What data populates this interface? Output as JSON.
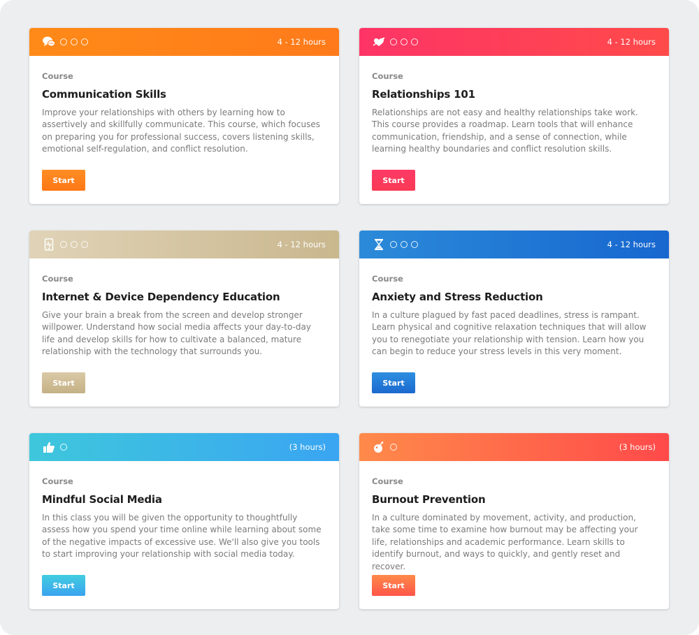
{
  "colors": {
    "background": "#edeef0",
    "orange": "#ff8a18",
    "red": "#fe3466",
    "tan": "#d6c8a5",
    "blue": "#2178d6",
    "cyan": "#3eb8e6",
    "coral": "#ff6a4a"
  },
  "cards": [
    {
      "icon": "chat-bubbles-icon",
      "duration": "4 - 12 hours",
      "label": "Course",
      "title": "Communication Skills",
      "description": "Improve your relationships with others by learning how to assertively and skillfully communicate. This course, which focuses on preparing you for professional success, covers listening skills, emotional self-regulation, and conflict resolution.",
      "button": "Start"
    },
    {
      "icon": "heart-arrow-icon",
      "duration": "4 - 12 hours",
      "label": "Course",
      "title": "Relationships 101",
      "description": "Relationships are not easy and healthy relationships take work. This course provides a roadmap. Learn tools that will enhance communication, friendship, and a sense of connection, while learning healthy boundaries and conflict resolution skills.",
      "button": "Start"
    },
    {
      "icon": "phone-heartbeat-icon",
      "duration": "4 - 12 hours",
      "label": "Course",
      "title": "Internet & Device Dependency Education",
      "description": "Give your brain a break from the screen and develop stronger willpower. Understand how social media affects your day-to-day life and develop skills for how to cultivate a balanced, mature relationship with the technology that surrounds you.",
      "button": "Start"
    },
    {
      "icon": "hourglass-icon",
      "duration": "4 - 12 hours",
      "label": "Course",
      "title": "Anxiety and Stress Reduction",
      "description": "In a culture plagued by fast paced deadlines, stress is rampant. Learn physical and cognitive relaxation techniques that will allow you to renegotiate your relationship with tension. Learn how you can begin to reduce your stress levels in this very moment.",
      "button": "Start"
    },
    {
      "icon": "thumbs-up-icon",
      "duration": "(3 hours)",
      "label": "Course",
      "title": "Mindful Social Media",
      "description": "In this class you will be given the opportunity to thoughtfully assess how you spend your time online while learning about some of the negative impacts of excessive use. We'll also give you tools to start improving your relationship with social media today.",
      "button": "Start"
    },
    {
      "icon": "bomb-icon",
      "duration": "(3 hours)",
      "label": "Course",
      "title": "Burnout Prevention",
      "description": "In a culture dominated by movement, activity, and production, take some time to examine how burnout may be affecting your life, relationships and academic performance. Learn skills to identify burnout, and ways to quickly, and gently reset and recover.",
      "button": "Start"
    }
  ]
}
